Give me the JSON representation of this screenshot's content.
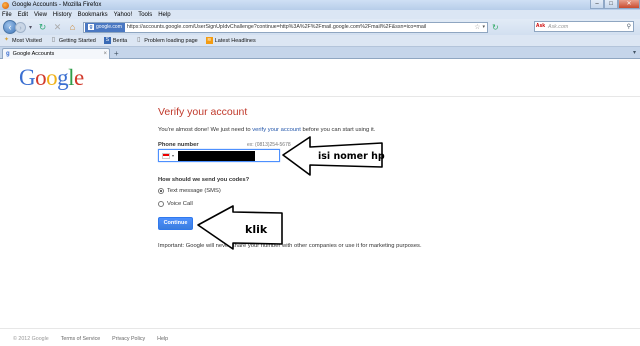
{
  "window": {
    "title": "Google Accounts - Mozilla Firefox",
    "minimize": "–",
    "maximize": "□",
    "close": "✕"
  },
  "menu": [
    "File",
    "Edit",
    "View",
    "History",
    "Bookmarks",
    "Yahoo!",
    "Tools",
    "Help"
  ],
  "nav": {
    "site_identity": "google.com",
    "url": "https://accounts.google.com/UserSignUpIdvChallenge?continue=http%3A%2F%2Fmail.google.com%2Fmail%2F&ssn=ico=mail",
    "search_placeholder": "Ask.com",
    "search_engine_label": "Ask"
  },
  "bookmarks": [
    "Most Visited",
    "Getting Started",
    "Berita",
    "Problem loading page",
    "Latest Headlines"
  ],
  "tab": {
    "label": "Google Accounts"
  },
  "logo": [
    "G",
    "o",
    "o",
    "g",
    "l",
    "e"
  ],
  "page": {
    "title": "Verify your account",
    "intro_before": "You're almost done! We just need to ",
    "intro_link": "verify your account",
    "intro_after": " before you can start using it.",
    "phone_label": "Phone number",
    "phone_example": "ex: (0813)254-5678",
    "send_label": "How should we send you codes?",
    "option_sms": "Text message (SMS)",
    "option_voice": "Voice Call",
    "selected_option": "Text message (SMS)",
    "continue_label": "Continue",
    "important": "Important: Google will never share your number with other companies or use it for marketing purposes."
  },
  "annotations": {
    "phone_hint": "isi nomer hp",
    "click_hint": "klik"
  },
  "footer": {
    "copyright": "© 2012 Google",
    "terms": "Terms of Service",
    "privacy": "Privacy Policy",
    "help": "Help"
  },
  "colors": {
    "title_red": "#c0392b",
    "link_blue": "#2255aa",
    "button_blue": "#4d90fe"
  }
}
